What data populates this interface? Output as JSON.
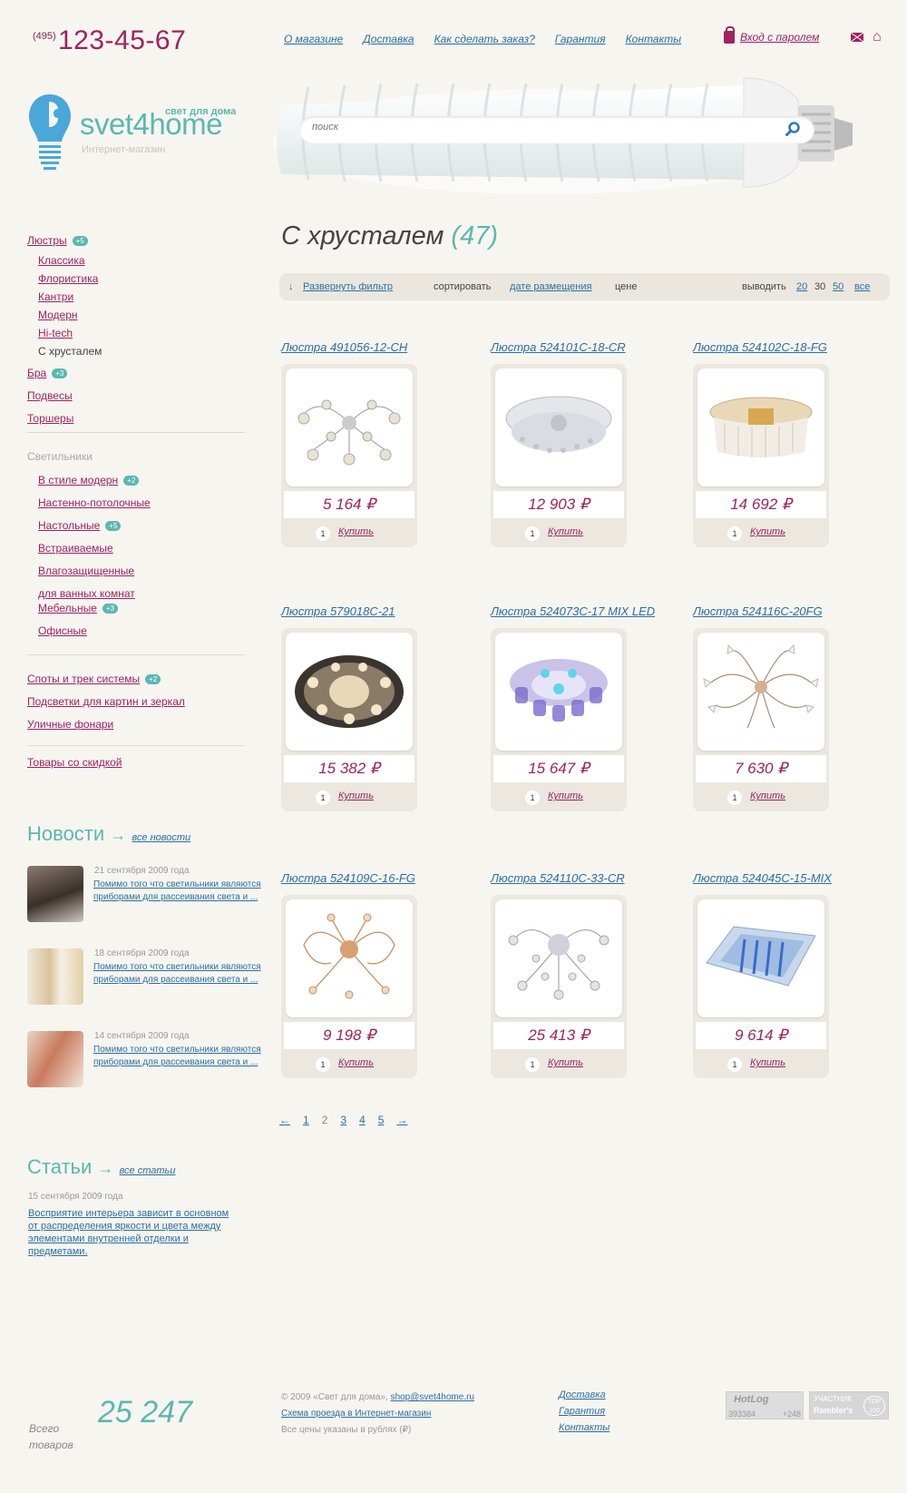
{
  "header": {
    "phone_code": "(495)",
    "phone_number": "123-45-67",
    "nav": [
      "О магазине",
      "Доставка",
      "Как сделать заказ?",
      "Гарантия",
      "Контакты"
    ],
    "login_label": "Вход с паролем"
  },
  "logo": {
    "name": "svet4home",
    "slogan": "свет для дома",
    "subtitle": "Интернет-магазин"
  },
  "search": {
    "placeholder": "поиск"
  },
  "sidebar": {
    "lustry": "Люстры",
    "lustry_badge": "+5",
    "sub": [
      "Классика",
      "Флористика",
      "Кантри",
      "Модерн",
      "Hi-tech"
    ],
    "current": "С хрусталем",
    "bra": "Бра",
    "bra_badge": "+3",
    "podvesy": "Подвесы",
    "torshery": "Торшеры",
    "svetilniki_head": "Светильники",
    "svet": [
      {
        "label": "В стиле модерн",
        "badge": "+2"
      },
      {
        "label": "Настенно-потолочные",
        "badge": ""
      },
      {
        "label": "Настольные",
        "badge": "+5"
      },
      {
        "label": "Встраиваемые",
        "badge": ""
      },
      {
        "label": "Влагозащищенные",
        "badge": ""
      },
      {
        "label": "для ванных комнат",
        "badge": ""
      },
      {
        "label": "Мебельные",
        "badge": "+3"
      },
      {
        "label": "Офисные",
        "badge": ""
      }
    ],
    "spoty": "Споты и трек системы",
    "spoty_badge": "+2",
    "podsvetki": "Подсветки для картин и зеркал",
    "ulichnye": "Уличные фонари",
    "skidka": "Товары со скидкой"
  },
  "news": {
    "title": "Новости",
    "arrow": "→",
    "all_link": "все новости",
    "items": [
      {
        "date": "21 сентября 2009 года",
        "text": "Помимо того что светильники являются приборами для рассеивания света и ..."
      },
      {
        "date": "18 сентября 2009 года",
        "text": "Помимо того что светильники являются приборами для рассеивания света и ..."
      },
      {
        "date": "14 сентября 2009 года",
        "text": "Помимо того что светильники являются приборами для рассеивания света и ..."
      }
    ]
  },
  "articles": {
    "title": "Статьи",
    "arrow": "→",
    "all_link": "все статьи",
    "date": "15 сентября 2009 года",
    "text": "Восприятие интерьера зависит в основном от распределения яркости и цвета между элементами внутренней отделки и предметами."
  },
  "category": {
    "title": "С хрусталем",
    "count": "(47)"
  },
  "filter": {
    "expand": "Развернуть фильтр",
    "sort_label": "сортировать",
    "sort_date": "дате размещения",
    "sort_price": "цене",
    "show_label": "выводить",
    "opt_20": "20",
    "opt_30": "30",
    "opt_50": "50",
    "opt_all": "все"
  },
  "products": [
    {
      "title": "Люстра 491056-12-CH",
      "price": "5 164 ₽",
      "qty": "1",
      "buy": "Купить"
    },
    {
      "title": "Люстра 524101C-18-CR",
      "price": "12 903 ₽",
      "qty": "1",
      "buy": "Купить"
    },
    {
      "title": "Люстра 524102C-18-FG",
      "price": "14 692 ₽",
      "qty": "1",
      "buy": "Купить"
    },
    {
      "title": "Люстра 579018C-21",
      "price": "15 382 ₽",
      "qty": "1",
      "buy": "Купить"
    },
    {
      "title": "Люстра 524073C-17 MIX LED",
      "price": "15 647 ₽",
      "qty": "1",
      "buy": "Купить"
    },
    {
      "title": "Люстра 524116C-20FG",
      "price": "7 630 ₽",
      "qty": "1",
      "buy": "Купить"
    },
    {
      "title": "Люстра 524109C-16-FG",
      "price": "9 198 ₽",
      "qty": "1",
      "buy": "Купить"
    },
    {
      "title": "Люстра 524110C-33-CR",
      "price": "25 413 ₽",
      "qty": "1",
      "buy": "Купить"
    },
    {
      "title": "Люстра 524045C-15-MIX",
      "price": "9 614 ₽",
      "qty": "1",
      "buy": "Купить"
    }
  ],
  "pager": {
    "prev": "←",
    "pages": [
      "1",
      "2",
      "3",
      "4",
      "5"
    ],
    "next": "→"
  },
  "footer": {
    "total_label_1": "Всего",
    "total_label_2": "товаров",
    "total": "25 247",
    "copy": "© 2009 «Свет для дома»,",
    "email": "shop@svet4home.ru",
    "map_link": "Схема проезда в Интернет-магазин",
    "prices_note": "Все цены указаны в рублях (₽)",
    "links": [
      "Доставка",
      "Гарантия",
      "Контакты"
    ],
    "hotlog": "HotLog",
    "hotlog_n1": "393384",
    "hotlog_n2": "+248",
    "rambler_1": "УЧАСТНИК",
    "rambler_2": "Rambler's",
    "rambler_3": "TOP 100"
  }
}
